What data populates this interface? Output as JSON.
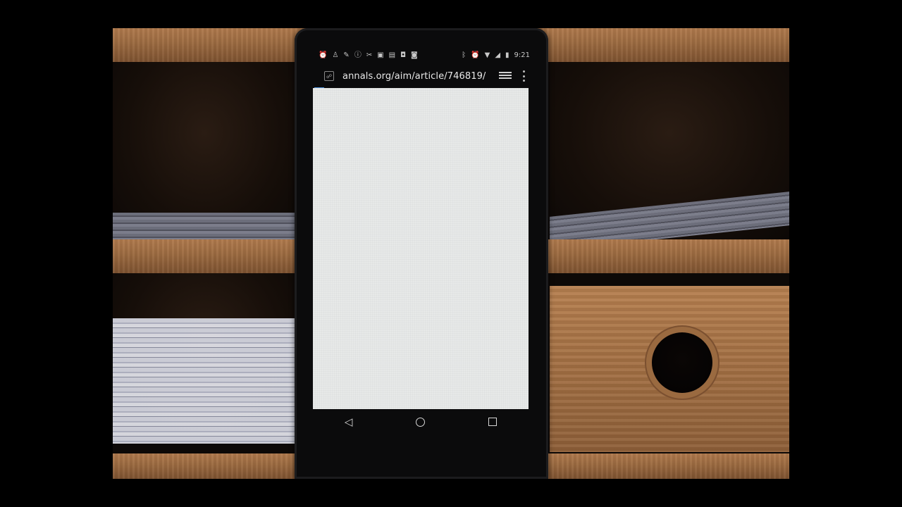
{
  "status_bar": {
    "time": "9:21",
    "left_icons": [
      "alarm-icon",
      "person-icon",
      "wrench-icon",
      "info-icon",
      "tools-icon",
      "lock-icon",
      "photos-icon",
      "camera-icon",
      "android-icon"
    ],
    "right_icons": [
      "bluetooth-icon",
      "alarm-icon",
      "wifi-icon",
      "signal-icon",
      "battery-icon"
    ]
  },
  "browser": {
    "url": "annals.org/aim/article/746819/"
  },
  "navigation": {
    "back_glyph": "◁"
  }
}
